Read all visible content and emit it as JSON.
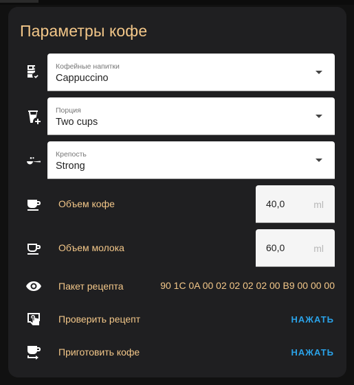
{
  "card": {
    "title": "Параметры кофе"
  },
  "drink": {
    "label": "Кофейные напитки",
    "value": "Cappuccino",
    "icon": "coffee-maker-check-icon"
  },
  "portion": {
    "label": "Порция",
    "value": "Two cups",
    "icon": "cup-plus-icon"
  },
  "strength": {
    "label": "Крепость",
    "value": "Strong",
    "icon": "coffee-scoop-icon"
  },
  "coffee_volume": {
    "label": "Объем кофе",
    "value": "40,0",
    "unit": "ml",
    "icon": "coffee-cup-filled-icon"
  },
  "milk_volume": {
    "label": "Объем молока",
    "value": "60,0",
    "unit": "ml",
    "icon": "coffee-cup-outline-icon"
  },
  "recipe_packet": {
    "label": "Пакет рецепта",
    "value": "90 1C 0A 00 02 02 02 02 00 B9 00 00 00",
    "icon": "eye-icon"
  },
  "check_recipe": {
    "label": "Проверить рецепт",
    "action": "НАЖАТЬ",
    "icon": "touch-screen-icon"
  },
  "make_coffee": {
    "label": "Приготовить кофе",
    "action": "НАЖАТЬ",
    "icon": "coffee-to-go-icon"
  },
  "colors": {
    "accent_text": "#f3c789",
    "action": "#2aa2e8",
    "card_bg": "#1f1f21"
  }
}
